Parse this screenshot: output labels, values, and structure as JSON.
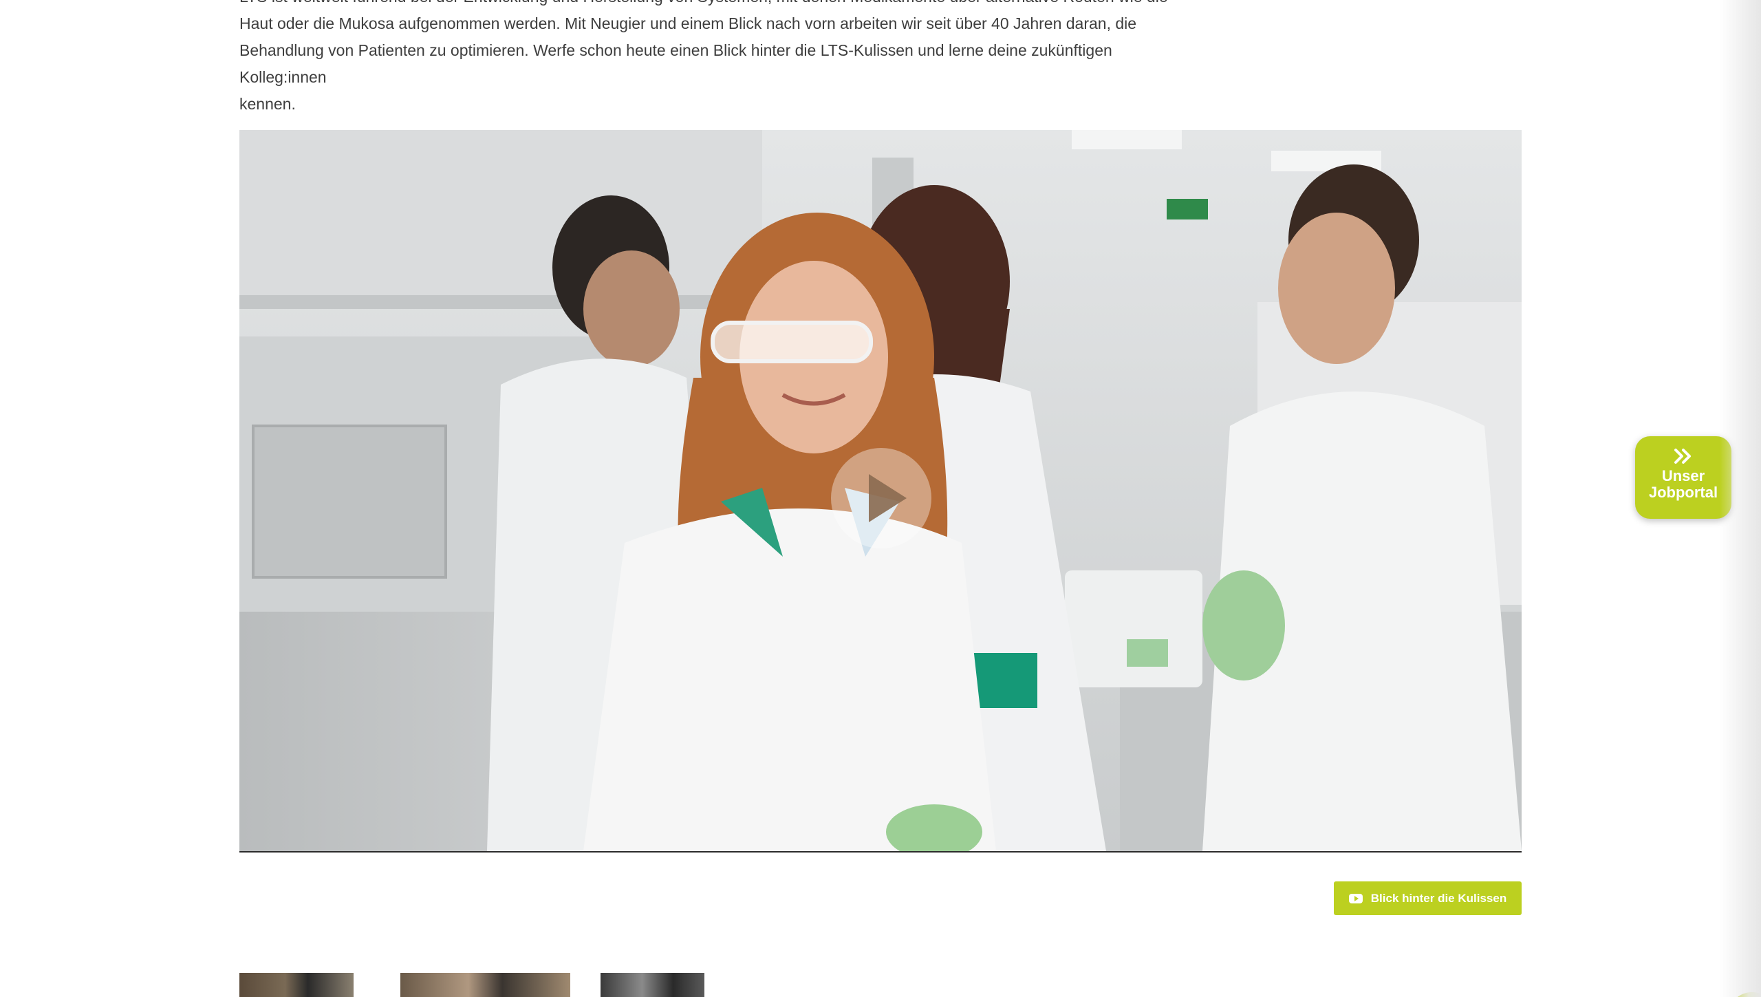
{
  "intro": {
    "lines": [
      "LTS ist weltweit führend bei der Entwicklung und Herstellung von Systemen, mit denen Medikamente über alternative Routen wie die",
      "Haut oder die Mukosa aufgenommen werden. Mit Neugier und einem Blick nach vorn arbeiten wir seit über 40 Jahren daran, die",
      "Behandlung von Patienten zu optimieren. Werfe schon heute einen Blick hinter die LTS-Kulissen und lerne deine zukünftigen Kolleg:innen",
      "kennen."
    ]
  },
  "video": {
    "play_icon": "play-icon"
  },
  "cta": {
    "label": "Blick hinter die Kulissen",
    "icon": "youtube-icon"
  },
  "jobportal": {
    "line1": "Unser",
    "line2": "Jobportal",
    "icon": "double-chevron-right-icon"
  },
  "colors": {
    "accent": "#bcd020",
    "text": "#3e3e3e"
  }
}
